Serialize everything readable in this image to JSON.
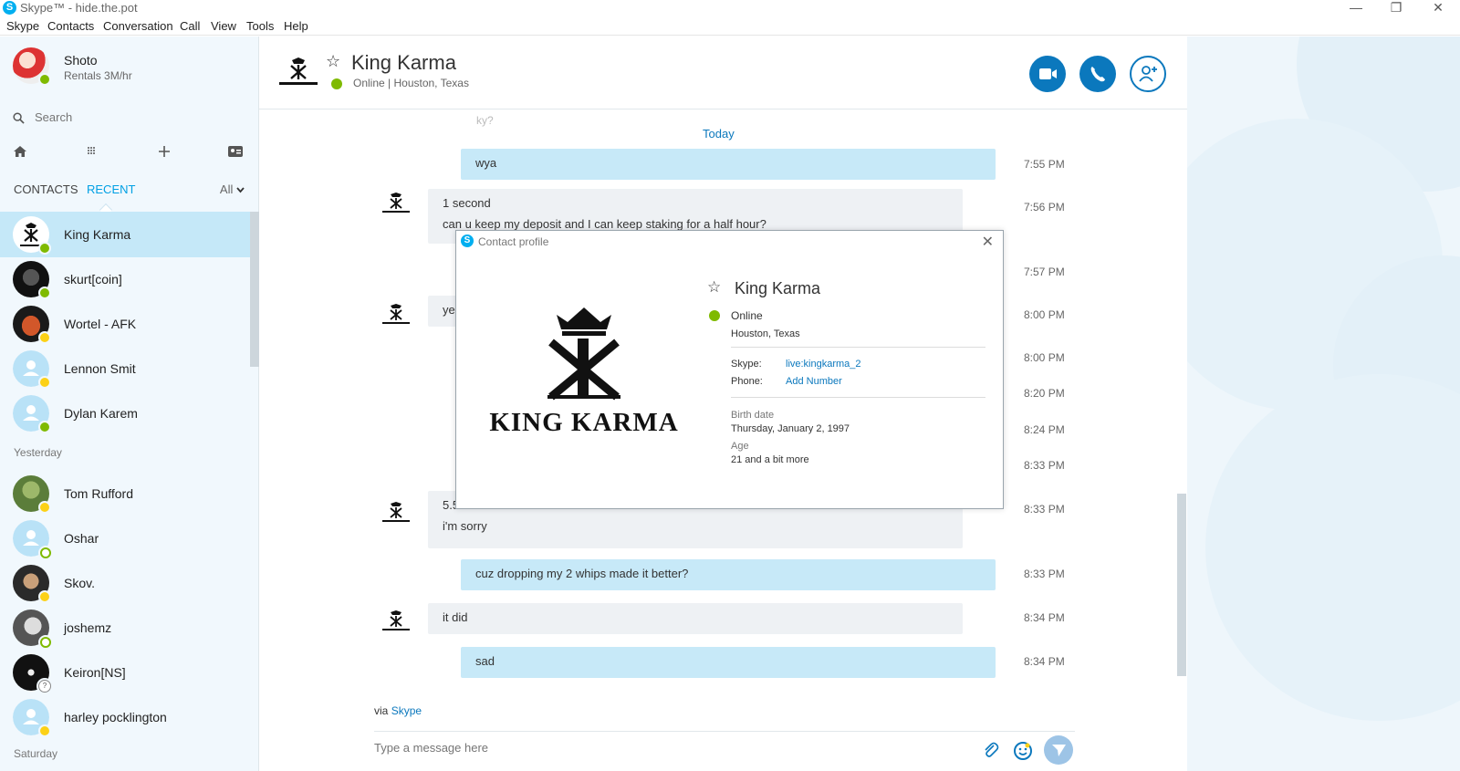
{
  "window": {
    "title": "Skype™ - hide.the.pot",
    "logo_glyph": "S",
    "minimize": "—",
    "restore": "❐",
    "close": "✕"
  },
  "menu": [
    "Skype",
    "Contacts",
    "Conversation",
    "Call",
    "View",
    "Tools",
    "Help"
  ],
  "me": {
    "name": "Shoto",
    "mood": "Rentals 3M/hr",
    "status": "online"
  },
  "search": {
    "placeholder": "Search"
  },
  "tabs": {
    "contacts": "CONTACTS",
    "recent": "RECENT",
    "filter": "All"
  },
  "recent": [
    {
      "name": "King Karma",
      "status": "online",
      "selected": true
    },
    {
      "name": "skurt[coin]",
      "status": "online"
    },
    {
      "name": "Wortel - AFK",
      "status": "away"
    },
    {
      "name": "Lennon Smit",
      "status": "away"
    },
    {
      "name": "Dylan Karem",
      "status": "online"
    }
  ],
  "groups": {
    "yesterday": "Yesterday",
    "saturday": "Saturday"
  },
  "yesterday": [
    {
      "name": "Tom Rufford",
      "status": "away"
    },
    {
      "name": "Oshar",
      "status": "offline"
    },
    {
      "name": "Skov.",
      "status": "away"
    },
    {
      "name": "joshemz",
      "status": "offline"
    },
    {
      "name": "Keiron[NS]",
      "status": "unknown"
    },
    {
      "name": "harley pocklington",
      "status": "away"
    }
  ],
  "chat": {
    "name": "King Karma",
    "status": "Online",
    "location": "Houston, Texas",
    "status_line": "Online  |  Houston, Texas",
    "day_label": "Today",
    "partial_top": "ky?",
    "via_prefix": "via",
    "via_link": "Skype",
    "compose_placeholder": "Type a message here"
  },
  "messages": [
    {
      "dir": "out",
      "text": "wya",
      "time": "7:55 PM"
    },
    {
      "dir": "in",
      "line1": "1 second",
      "line2": "can u keep my deposit and I can keep staking for a half hour?",
      "time": "7:56 PM"
    },
    {
      "time": "7:57 PM"
    },
    {
      "dir": "in",
      "text": "ye",
      "time": "8:00 PM"
    },
    {
      "time": "8:00 PM"
    },
    {
      "time": "8:20 PM"
    },
    {
      "time": "8:24 PM"
    },
    {
      "time": "8:33 PM"
    },
    {
      "dir": "in",
      "line1": "5.5bil",
      "line2": "i'm sorry",
      "time": "8:33 PM"
    },
    {
      "dir": "out",
      "text": "cuz dropping my 2 whips made it better?",
      "time": "8:33 PM"
    },
    {
      "dir": "in",
      "text": "it did",
      "time": "8:34 PM"
    },
    {
      "dir": "out",
      "text": "sad",
      "time": "8:34 PM"
    }
  ],
  "profile": {
    "dialog_title": "Contact profile",
    "close_glyph": "✕",
    "logo_text": "KING KARMA",
    "name": "King Karma",
    "status": "Online",
    "location": "Houston, Texas",
    "skype_label": "Skype:",
    "skype_value": "live:kingkarma_2",
    "phone_label": "Phone:",
    "phone_value": "Add Number",
    "birth_label": "Birth date",
    "birth_value": "Thursday, January 2, 1997",
    "age_label": "Age",
    "age_value": "21 and a bit more"
  },
  "colors": {
    "brand": "#00aff0",
    "accent": "#0b78bd",
    "online": "#7fba00",
    "away": "#fcd116",
    "selected_row": "#c5e8f8",
    "outgoing_bubble": "#c7e9f8",
    "incoming_bubble": "#eef1f4"
  }
}
